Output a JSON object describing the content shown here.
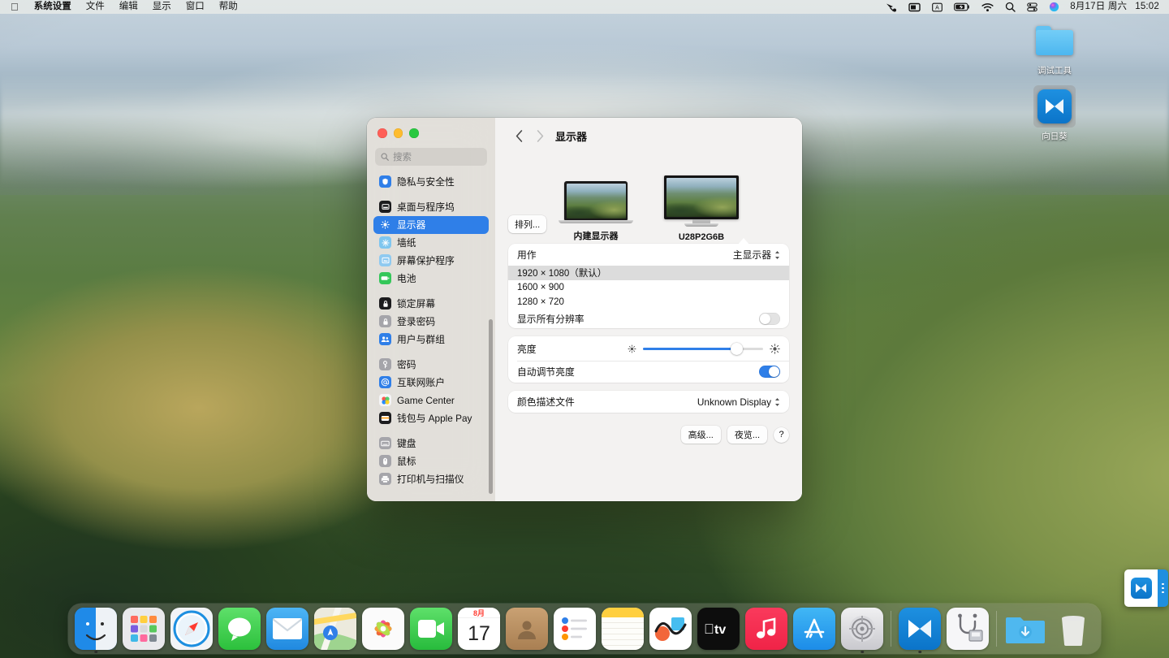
{
  "menubar": {
    "apple_icon": "apple-logo-icon",
    "items": [
      {
        "label": "系统设置",
        "bold": true
      },
      {
        "label": "文件",
        "bold": false
      },
      {
        "label": "编辑",
        "bold": false
      },
      {
        "label": "显示",
        "bold": false
      },
      {
        "label": "窗口",
        "bold": false
      },
      {
        "label": "帮助",
        "bold": false
      }
    ],
    "status_icons": [
      "screen-sharing-icon",
      "screen-mirroring-icon",
      "input-source-icon",
      "battery-charging-icon",
      "wifi-icon",
      "spotlight-search-icon",
      "control-center-icon",
      "siri-icon"
    ],
    "input_source_label": "A",
    "date": "8月17日 周六",
    "time": "15:02"
  },
  "desktop": {
    "icons": [
      {
        "label": "调试工具",
        "type": "folder",
        "selected": false
      },
      {
        "label": "向日葵",
        "type": "app",
        "selected": true
      }
    ]
  },
  "window": {
    "title": "显示器",
    "search": {
      "placeholder": "搜索"
    },
    "sidebar": {
      "groups": [
        {
          "items": [
            {
              "label": "隐私与安全性",
              "icon": "hand-shield-icon",
              "color": "#2f7fe8",
              "active": false
            }
          ]
        },
        {
          "items": [
            {
              "label": "桌面与程序坞",
              "icon": "desktop-dock-icon",
              "color": "#1c1c1e",
              "active": false
            },
            {
              "label": "显示器",
              "icon": "brightness-icon",
              "color": "#2f7fe8",
              "active": true
            },
            {
              "label": "墙纸",
              "icon": "wallpaper-icon",
              "color": "#7fc6ef",
              "active": false
            },
            {
              "label": "屏幕保护程序",
              "icon": "screensaver-icon",
              "color": "#8fcaf0",
              "active": false
            },
            {
              "label": "电池",
              "icon": "battery-icon",
              "color": "#34c759",
              "active": false
            }
          ]
        },
        {
          "items": [
            {
              "label": "锁定屏幕",
              "icon": "lock-screen-icon",
              "color": "#1c1c1e",
              "active": false
            },
            {
              "label": "登录密码",
              "icon": "login-password-icon",
              "color": "#a5a5aa",
              "active": false
            },
            {
              "label": "用户与群组",
              "icon": "users-groups-icon",
              "color": "#2f7fe8",
              "active": false
            }
          ]
        },
        {
          "items": [
            {
              "label": "密码",
              "icon": "key-icon",
              "color": "#a5a5aa",
              "active": false
            },
            {
              "label": "互联网账户",
              "icon": "at-sign-icon",
              "color": "#2f7fe8",
              "active": false
            },
            {
              "label": "Game Center",
              "icon": "game-center-icon",
              "color": "#f5f5f7",
              "active": false
            },
            {
              "label": "钱包与 Apple Pay",
              "icon": "wallet-icon",
              "color": "#1c1c1e",
              "active": false
            }
          ]
        },
        {
          "items": [
            {
              "label": "键盘",
              "icon": "keyboard-icon",
              "color": "#a5a5aa",
              "active": false
            },
            {
              "label": "鼠标",
              "icon": "mouse-icon",
              "color": "#a5a5aa",
              "active": false
            },
            {
              "label": "打印机与扫描仪",
              "icon": "printer-icon",
              "color": "#a5a5aa",
              "active": false
            }
          ]
        }
      ]
    },
    "displays": {
      "arrange_button": "排列...",
      "items": [
        {
          "name": "内建显示器",
          "type": "laptop",
          "selected": true
        },
        {
          "name": "U28P2G6B",
          "type": "monitor",
          "selected": false
        }
      ]
    },
    "use_as": {
      "label": "用作",
      "value": "主显示器"
    },
    "resolutions": [
      {
        "label": "1920 × 1080（默认）",
        "selected": true
      },
      {
        "label": "1600 × 900",
        "selected": false
      },
      {
        "label": "1280 × 720",
        "selected": false
      }
    ],
    "show_all_resolutions": {
      "label": "显示所有分辨率",
      "on": false
    },
    "brightness": {
      "label": "亮度",
      "value_percent": 78,
      "low_icon": "brightness-low-icon",
      "high_icon": "brightness-high-icon"
    },
    "auto_brightness": {
      "label": "自动调节亮度",
      "on": true
    },
    "color_profile": {
      "label": "颜色描述文件",
      "value": "Unknown Display"
    },
    "buttons": {
      "advanced": "高级...",
      "night_shift": "夜览...",
      "help": "?"
    },
    "accent_color": "#2f7fe8"
  },
  "dock": {
    "apps": [
      {
        "name": "finder",
        "running": true
      },
      {
        "name": "launchpad",
        "running": false
      },
      {
        "name": "safari",
        "running": false
      },
      {
        "name": "messages",
        "running": false
      },
      {
        "name": "mail",
        "running": false
      },
      {
        "name": "maps",
        "running": false
      },
      {
        "name": "photos",
        "running": false
      },
      {
        "name": "facetime",
        "running": false
      },
      {
        "name": "calendar",
        "running": false,
        "month": "8月",
        "day": "17"
      },
      {
        "name": "contacts",
        "running": false
      },
      {
        "name": "reminders",
        "running": false
      },
      {
        "name": "notes",
        "running": false
      },
      {
        "name": "freeform",
        "running": false
      },
      {
        "name": "apple-tv",
        "running": false
      },
      {
        "name": "music",
        "running": false
      },
      {
        "name": "app-store",
        "running": false
      },
      {
        "name": "system-settings",
        "running": true
      },
      {
        "name": "sunflower",
        "running": true
      },
      {
        "name": "disk-utility",
        "running": false
      }
    ],
    "folders": [
      {
        "name": "downloads-folder"
      },
      {
        "name": "trash"
      }
    ]
  },
  "floating_widget": {
    "name": "sunflower-floating-toolbar",
    "menu_icon": "vertical-dots-icon"
  }
}
